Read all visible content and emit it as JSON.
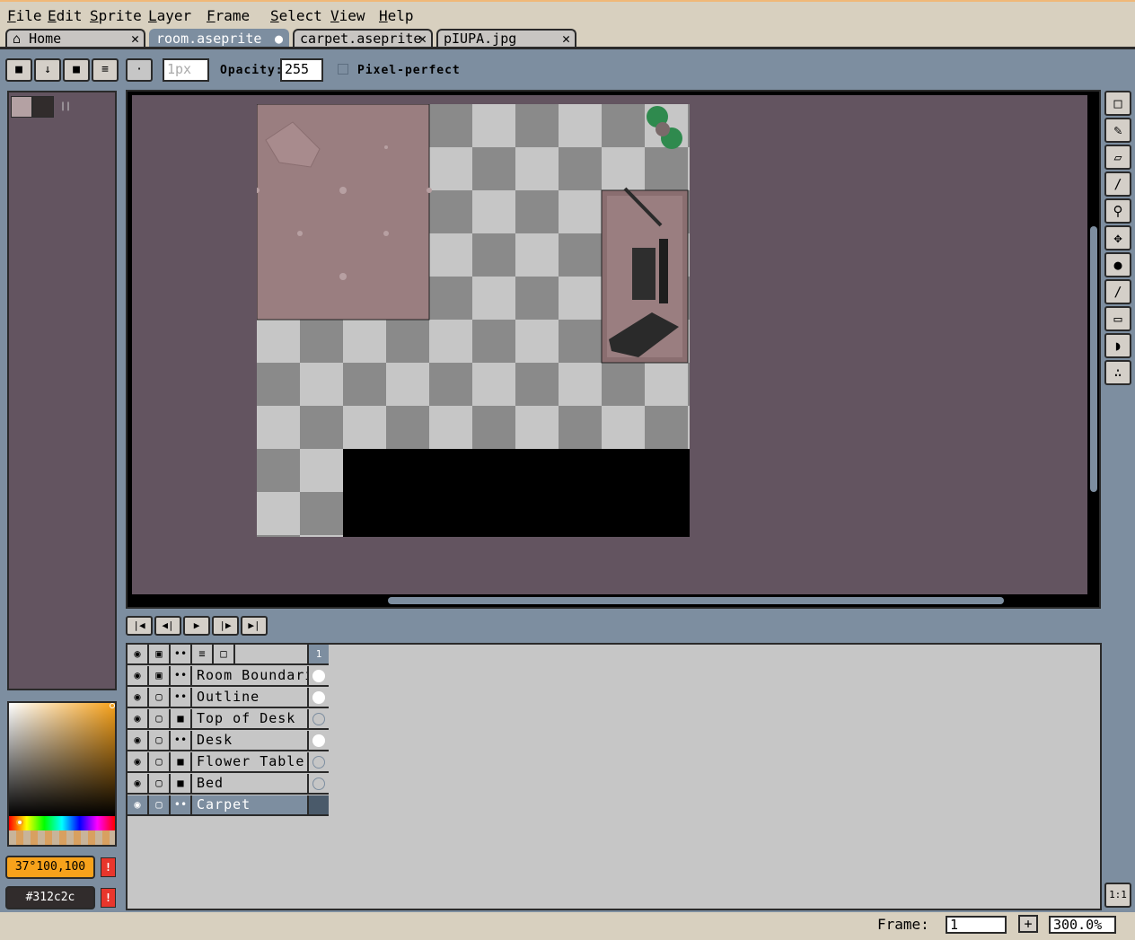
{
  "menu": [
    "File",
    "Edit",
    "Sprite",
    "Layer",
    "Frame",
    "Select",
    "View",
    "Help"
  ],
  "tabs": [
    {
      "label": "Home",
      "icon": "home-icon"
    },
    {
      "label": "room.aseprite",
      "modified": true
    },
    {
      "label": "carpet.aseprite"
    },
    {
      "label": "pIUPA.jpg"
    }
  ],
  "toolbar": {
    "brush_size": "1px",
    "opacity_label": "Opacity:",
    "opacity_value": "255",
    "pixel_perfect_label": "Pixel-perfect"
  },
  "palette": {
    "swatch_colors": [
      "#b4a1a3",
      "#312c2c"
    ],
    "fg_label": "37°100,100",
    "bg_label": "#312c2c",
    "fg_color": "#f7a21b",
    "bg_color": "#312c2c",
    "warn": "!"
  },
  "canvas": {
    "background": "#635460",
    "zoom": "300.0%"
  },
  "tools": [
    "rectangular-marquee-icon",
    "pencil-icon",
    "eraser-icon",
    "eyedropper-icon",
    "zoom-icon",
    "move-icon",
    "paint-bucket-icon",
    "line-icon",
    "rectangle-icon",
    "contour-icon",
    "spray-icon"
  ],
  "timeline": {
    "frame_header": "1",
    "layers": [
      {
        "name": "Room Boundaries",
        "type": "link",
        "cel": "filled",
        "locked": true
      },
      {
        "name": "Outline",
        "type": "link",
        "cel": "filled",
        "locked": false
      },
      {
        "name": "Top of Desk",
        "type": "group",
        "cel": "empty",
        "locked": false
      },
      {
        "name": "Desk",
        "type": "link",
        "cel": "filled",
        "locked": false
      },
      {
        "name": "Flower Table",
        "type": "group",
        "cel": "empty",
        "locked": false
      },
      {
        "name": "Bed",
        "type": "group",
        "cel": "empty",
        "locked": false
      },
      {
        "name": "Carpet",
        "type": "link",
        "cel": "selected",
        "locked": false
      }
    ]
  },
  "status": {
    "frame_label": "Frame:",
    "frame_value": "1",
    "zoom_value": "300.0%",
    "plus": "+",
    "one_to_one": "1:1"
  }
}
